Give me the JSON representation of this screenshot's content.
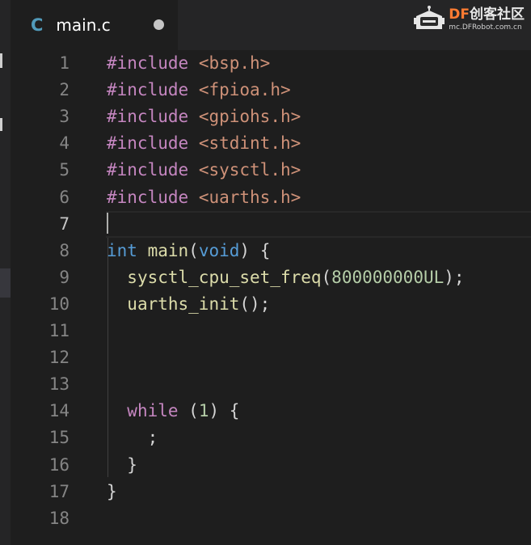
{
  "tab": {
    "icon": "C",
    "title": "main.c",
    "dirty_indicator": "unsaved-dot"
  },
  "watermark": {
    "brand_df": "DF",
    "brand_cn": "创客社区",
    "url": "mc.DFRobot.com.cn"
  },
  "editor": {
    "current_line": 7,
    "line_numbers": [
      "1",
      "2",
      "3",
      "4",
      "5",
      "6",
      "7",
      "8",
      "9",
      "10",
      "11",
      "12",
      "13",
      "14",
      "15",
      "16",
      "17",
      "18"
    ],
    "lines": [
      [
        {
          "t": "kw",
          "v": "#include"
        },
        {
          "t": "pn",
          "v": " "
        },
        {
          "t": "str",
          "v": "<bsp.h>"
        }
      ],
      [
        {
          "t": "kw",
          "v": "#include"
        },
        {
          "t": "pn",
          "v": " "
        },
        {
          "t": "str",
          "v": "<fpioa.h>"
        }
      ],
      [
        {
          "t": "kw",
          "v": "#include"
        },
        {
          "t": "pn",
          "v": " "
        },
        {
          "t": "str",
          "v": "<gpiohs.h>"
        }
      ],
      [
        {
          "t": "kw",
          "v": "#include"
        },
        {
          "t": "pn",
          "v": " "
        },
        {
          "t": "str",
          "v": "<stdint.h>"
        }
      ],
      [
        {
          "t": "kw",
          "v": "#include"
        },
        {
          "t": "pn",
          "v": " "
        },
        {
          "t": "str",
          "v": "<sysctl.h>"
        }
      ],
      [
        {
          "t": "kw",
          "v": "#include"
        },
        {
          "t": "pn",
          "v": " "
        },
        {
          "t": "str",
          "v": "<uarths.h>"
        }
      ],
      [],
      [
        {
          "t": "ty",
          "v": "int"
        },
        {
          "t": "pn",
          "v": " "
        },
        {
          "t": "fn",
          "v": "main"
        },
        {
          "t": "pn",
          "v": "("
        },
        {
          "t": "ty",
          "v": "void"
        },
        {
          "t": "pn",
          "v": ") {"
        }
      ],
      [
        {
          "t": "pn",
          "v": "  "
        },
        {
          "t": "fn",
          "v": "sysctl_cpu_set_freq"
        },
        {
          "t": "pn",
          "v": "("
        },
        {
          "t": "num",
          "v": "800000000UL"
        },
        {
          "t": "pn",
          "v": ");"
        }
      ],
      [
        {
          "t": "pn",
          "v": "  "
        },
        {
          "t": "fn",
          "v": "uarths_init"
        },
        {
          "t": "pn",
          "v": "();"
        }
      ],
      [],
      [],
      [],
      [
        {
          "t": "pn",
          "v": "  "
        },
        {
          "t": "kw",
          "v": "while"
        },
        {
          "t": "pn",
          "v": " ("
        },
        {
          "t": "num",
          "v": "1"
        },
        {
          "t": "pn",
          "v": ") {"
        }
      ],
      [
        {
          "t": "pn",
          "v": "    ;"
        }
      ],
      [
        {
          "t": "pn",
          "v": "  }"
        }
      ],
      [
        {
          "t": "pn",
          "v": "}"
        }
      ],
      []
    ]
  },
  "colors": {
    "background": "#1e1e1e",
    "keyword": "#c586c0",
    "string": "#ce9178",
    "type": "#569cd6",
    "function": "#dcdcaa",
    "number": "#b5cea8",
    "line_number": "#858585"
  }
}
